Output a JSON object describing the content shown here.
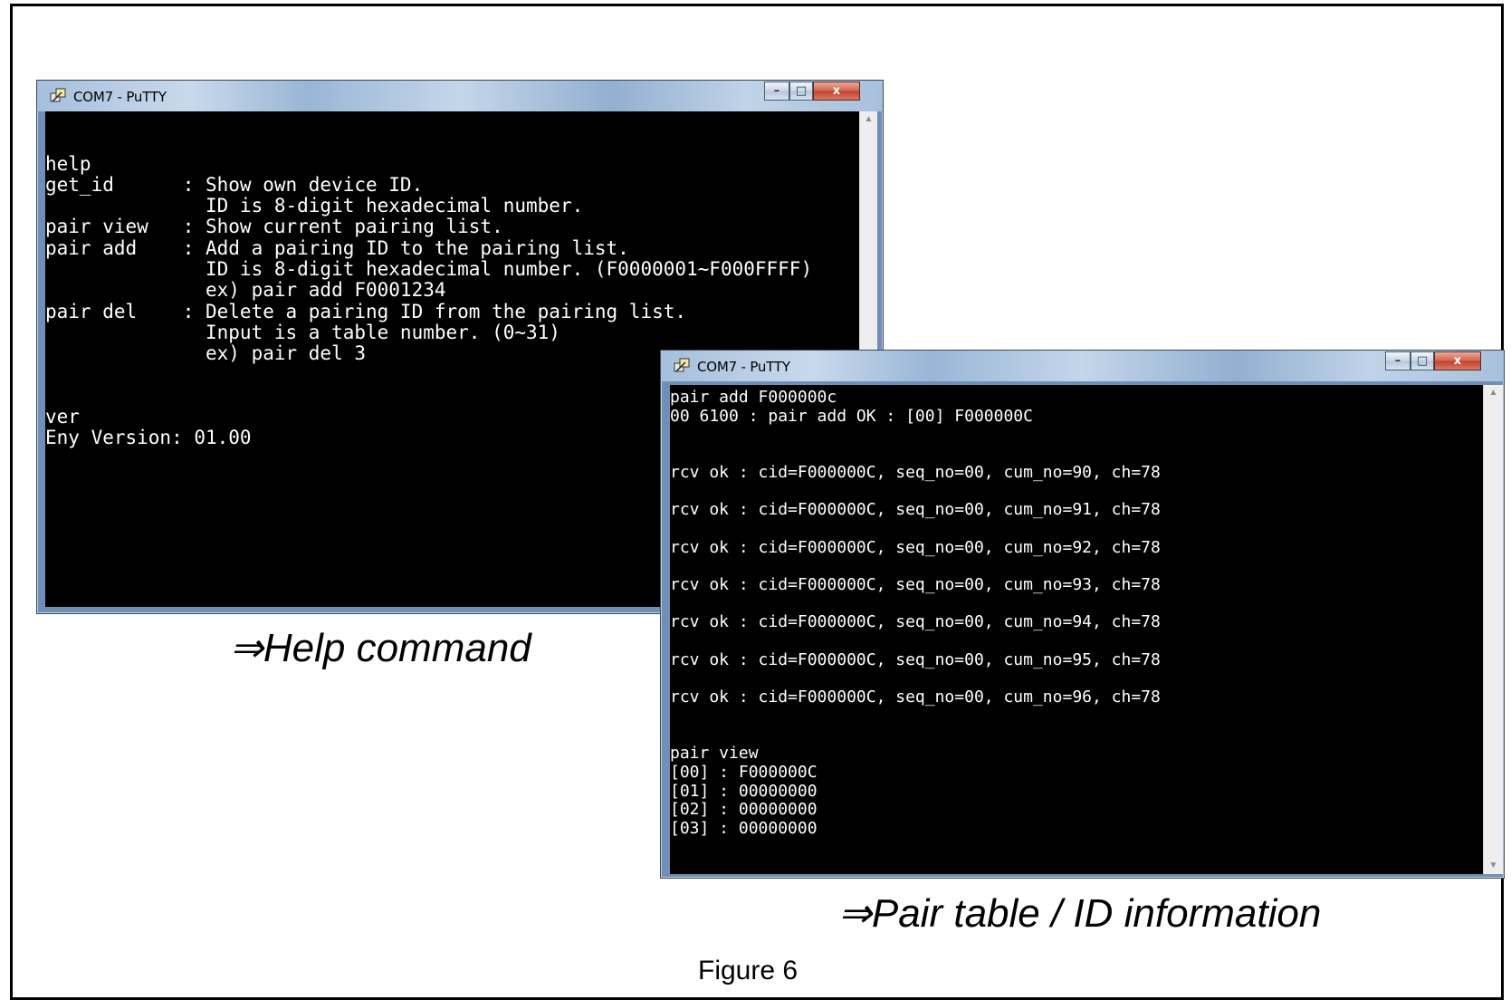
{
  "window_help": {
    "title": "COM7 - PuTTY",
    "lines": [
      "",
      "",
      "help",
      "get_id      : Show own device ID.",
      "              ID is 8-digit hexadecimal number.",
      "pair view   : Show current pairing list.",
      "pair add    : Add a pairing ID to the pairing list.",
      "              ID is 8-digit hexadecimal number. (F0000001~F000FFFF)",
      "              ex) pair add F0001234",
      "pair del    : Delete a pairing ID from the pairing list.",
      "              Input is a table number. (0~31)",
      "              ex) pair del 3",
      "",
      "",
      "ver",
      "Eny Version: 01.00"
    ]
  },
  "window_pair": {
    "title": "COM7 - PuTTY",
    "lines": [
      "pair add F000000c",
      "00 6100 : pair add OK : [00] F000000C",
      "",
      "",
      "rcv ok : cid=F000000C, seq_no=00, cum_no=90, ch=78",
      "",
      "rcv ok : cid=F000000C, seq_no=00, cum_no=91, ch=78",
      "",
      "rcv ok : cid=F000000C, seq_no=00, cum_no=92, ch=78",
      "",
      "rcv ok : cid=F000000C, seq_no=00, cum_no=93, ch=78",
      "",
      "rcv ok : cid=F000000C, seq_no=00, cum_no=94, ch=78",
      "",
      "rcv ok : cid=F000000C, seq_no=00, cum_no=95, ch=78",
      "",
      "rcv ok : cid=F000000C, seq_no=00, cum_no=96, ch=78",
      "",
      "",
      "pair view",
      "[00] : F000000C",
      "[01] : 00000000",
      "[02] : 00000000",
      "[03] : 00000000"
    ]
  },
  "captions": {
    "help": "⇒Help command",
    "pair": "⇒Pair table / ID information",
    "figure": "Figure 6"
  },
  "window_buttons": {
    "minimize": "–",
    "maximize": "□",
    "close": "x"
  },
  "colors": {
    "console_bg": "#000000",
    "console_fg": "#ffffff",
    "close_button": "#c2402b"
  },
  "icons": {
    "app": "putty-icon",
    "scroll_up": "scroll-up-arrow-icon",
    "scroll_down": "scroll-down-arrow-icon"
  }
}
